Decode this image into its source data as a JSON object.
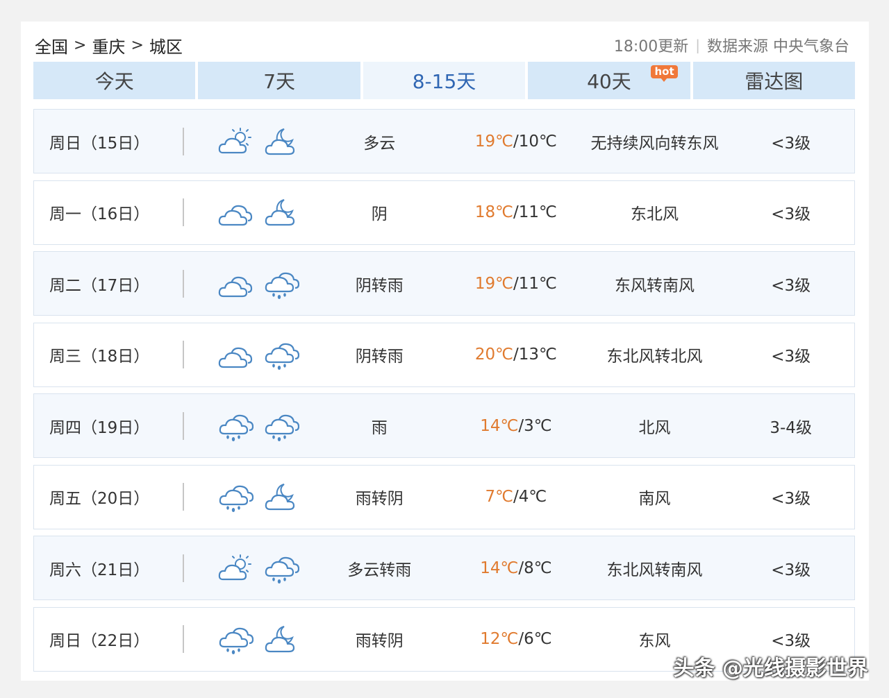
{
  "breadcrumb": {
    "country": "全国",
    "province": "重庆",
    "district": "城区",
    "separator": ">"
  },
  "header": {
    "update_time": "18:00更新",
    "divider": "|",
    "data_source": "数据来源 中央气象台"
  },
  "tabs": [
    {
      "label": "今天",
      "active": false
    },
    {
      "label": "7天",
      "active": false
    },
    {
      "label": "8-15天",
      "active": true
    },
    {
      "label": "40天",
      "active": false,
      "badge": "hot"
    },
    {
      "label": "雷达图",
      "active": false
    }
  ],
  "forecast": [
    {
      "day": "周日（15日）",
      "icon_day": "partly-cloudy-day-icon",
      "icon_night": "partly-cloudy-night-icon",
      "desc": "多云",
      "high": "19℃",
      "low": "10℃",
      "wind": "无持续风向转东风",
      "level": "<3级"
    },
    {
      "day": "周一（16日）",
      "icon_day": "overcast-icon",
      "icon_night": "partly-cloudy-night-icon",
      "desc": "阴",
      "high": "18℃",
      "low": "11℃",
      "wind": "东北风",
      "level": "<3级"
    },
    {
      "day": "周二（17日）",
      "icon_day": "overcast-icon",
      "icon_night": "rain-icon",
      "desc": "阴转雨",
      "high": "19℃",
      "low": "11℃",
      "wind": "东风转南风",
      "level": "<3级"
    },
    {
      "day": "周三（18日）",
      "icon_day": "overcast-icon",
      "icon_night": "rain-icon",
      "desc": "阴转雨",
      "high": "20℃",
      "low": "13℃",
      "wind": "东北风转北风",
      "level": "<3级"
    },
    {
      "day": "周四（19日）",
      "icon_day": "rain-icon",
      "icon_night": "rain-icon",
      "desc": "雨",
      "high": "14℃",
      "low": "3℃",
      "wind": "北风",
      "level": "3-4级"
    },
    {
      "day": "周五（20日）",
      "icon_day": "rain-icon",
      "icon_night": "partly-cloudy-night-icon",
      "desc": "雨转阴",
      "high": "7℃",
      "low": "4℃",
      "wind": "南风",
      "level": "<3级"
    },
    {
      "day": "周六（21日）",
      "icon_day": "partly-cloudy-day-icon",
      "icon_night": "rain-icon",
      "desc": "多云转雨",
      "high": "14℃",
      "low": "8℃",
      "wind": "东北风转南风",
      "level": "<3级"
    },
    {
      "day": "周日（22日）",
      "icon_day": "rain-icon",
      "icon_night": "partly-cloudy-night-icon",
      "desc": "雨转阴",
      "high": "12℃",
      "low": "6℃",
      "wind": "东风",
      "level": "<3级"
    }
  ],
  "watermark": "头条 @光线摄影世界",
  "colors": {
    "tab_bg": "#d6e8f8",
    "tab_active_text": "#2f66b3",
    "high_temp": "#e07a2e",
    "icon_stroke": "#4a87c3",
    "hot_badge": "#f0783a"
  }
}
